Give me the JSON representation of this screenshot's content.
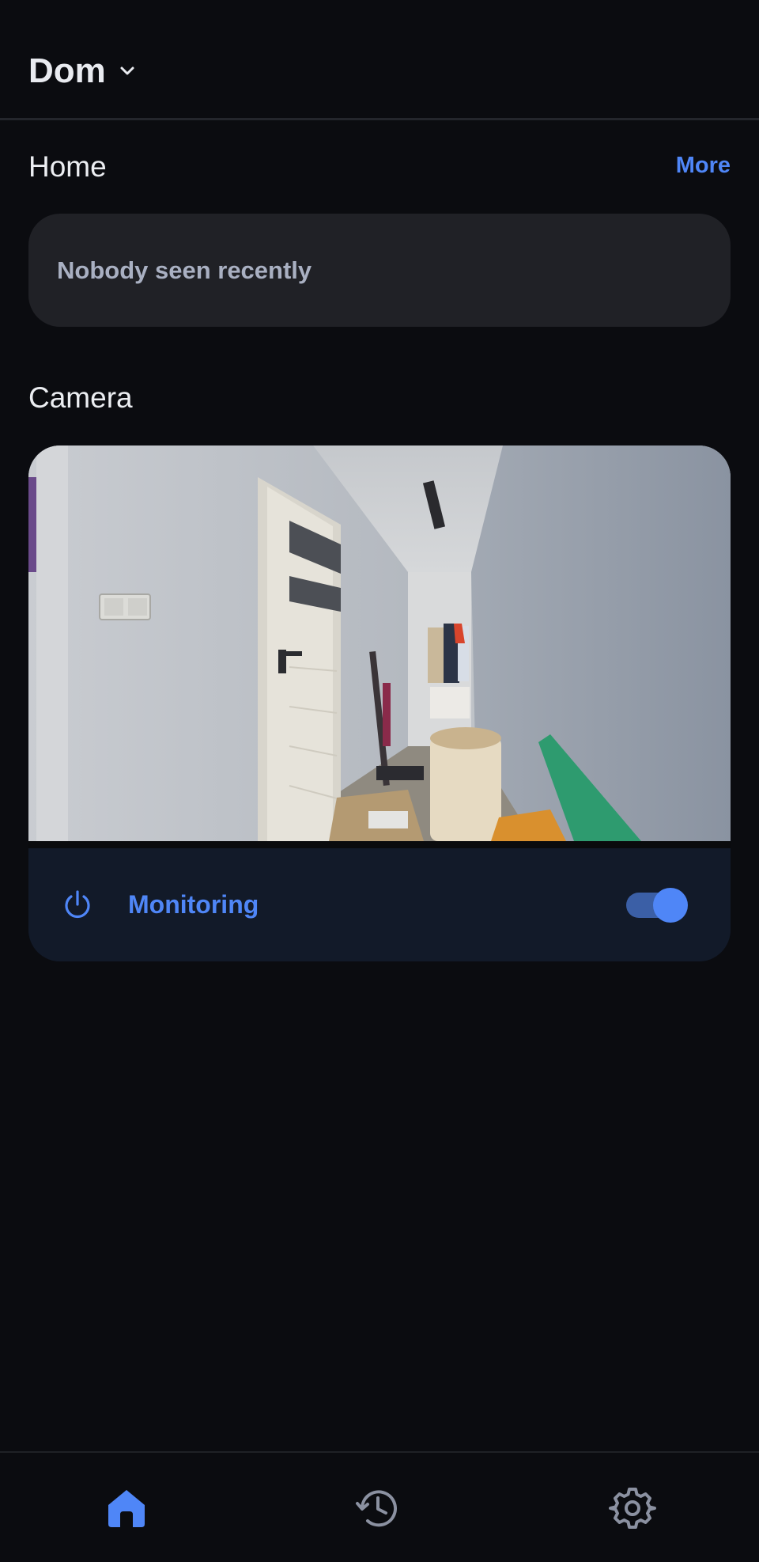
{
  "header": {
    "home_name": "Dom"
  },
  "home_section": {
    "title": "Home",
    "more_label": "More",
    "status_text": "Nobody seen recently"
  },
  "camera_section": {
    "title": "Camera",
    "monitoring_label": "Monitoring",
    "monitoring_enabled": true
  },
  "colors": {
    "accent": "#4f86f7",
    "background": "#0b0c10",
    "card": "#202126",
    "camera_bar": "#121a29"
  },
  "icons": {
    "home_switcher": "chevron-down-icon",
    "monitoring": "power-icon",
    "nav": [
      "home-icon",
      "history-icon",
      "settings-icon"
    ]
  }
}
